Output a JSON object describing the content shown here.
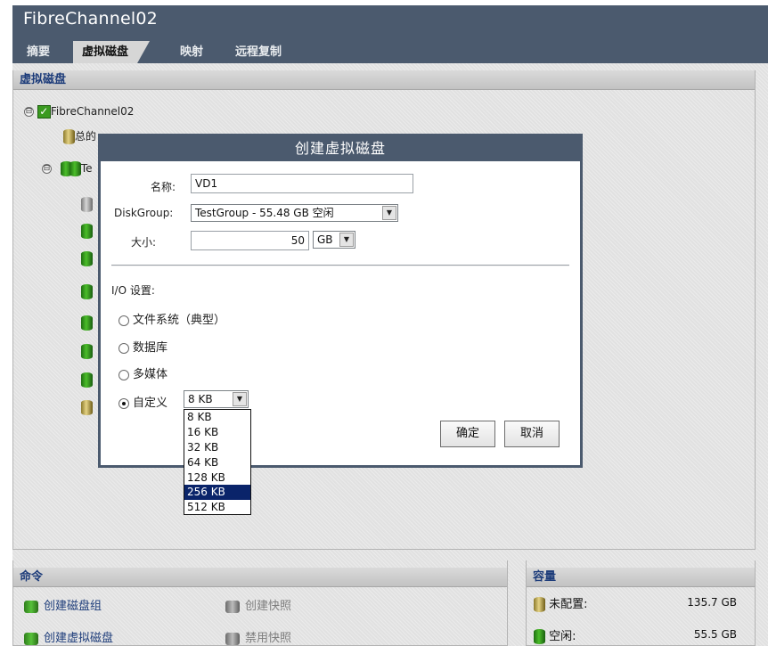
{
  "app": {
    "title": "FibreChannel02"
  },
  "tabs": [
    {
      "label": "摘要"
    },
    {
      "label": "虚拟磁盘"
    },
    {
      "label": "映射"
    },
    {
      "label": "远程复制"
    }
  ],
  "virtual_disk_panel": {
    "title": "虚拟磁盘",
    "tree": {
      "root_label": "FibreChannel02",
      "expander_collapse": "⊟",
      "total_prefix": "总的",
      "group_prefix": "Te"
    }
  },
  "dialog": {
    "title": "创建虚拟磁盘",
    "name_label": "名称:",
    "name_value": "VD1",
    "diskgroup_label": "DiskGroup:",
    "diskgroup_value": "TestGroup - 55.48 GB 空闲",
    "size_label": "大小:",
    "size_value": "50",
    "size_unit": "GB",
    "io_label": "I/O 设置:",
    "radio_options": [
      {
        "label": "文件系统（典型）",
        "checked": false
      },
      {
        "label": "数据库",
        "checked": false
      },
      {
        "label": "多媒体",
        "checked": false
      },
      {
        "label": "自定义",
        "checked": true
      }
    ],
    "custom_select_value": "8 KB",
    "custom_options": [
      "8 KB",
      "16 KB",
      "32 KB",
      "64 KB",
      "128 KB",
      "256 KB",
      "512 KB"
    ],
    "custom_highlighted": "256 KB",
    "ok_label": "确定",
    "cancel_label": "取消"
  },
  "commands_panel": {
    "title": "命令",
    "items": [
      {
        "label": "创建磁盘组",
        "enabled": true,
        "icon": "disk-group-icon"
      },
      {
        "label": "创建快照",
        "enabled": false,
        "icon": "snapshot-icon"
      },
      {
        "label": "创建虚拟磁盘",
        "enabled": true,
        "icon": "virtual-disk-icon"
      },
      {
        "label": "禁用快照",
        "enabled": false,
        "icon": "disable-snapshot-icon"
      }
    ]
  },
  "capacity_panel": {
    "title": "容量",
    "rows": [
      {
        "label": "未配置:",
        "value": "135.7 GB",
        "icon": "unconfigured-disk-icon"
      },
      {
        "label": "空闲:",
        "value": "55.5 GB",
        "icon": "free-disk-icon"
      }
    ]
  },
  "colors": {
    "header": "#4b5a6e",
    "link": "#1d3c7a",
    "selection": "#0a246a"
  }
}
